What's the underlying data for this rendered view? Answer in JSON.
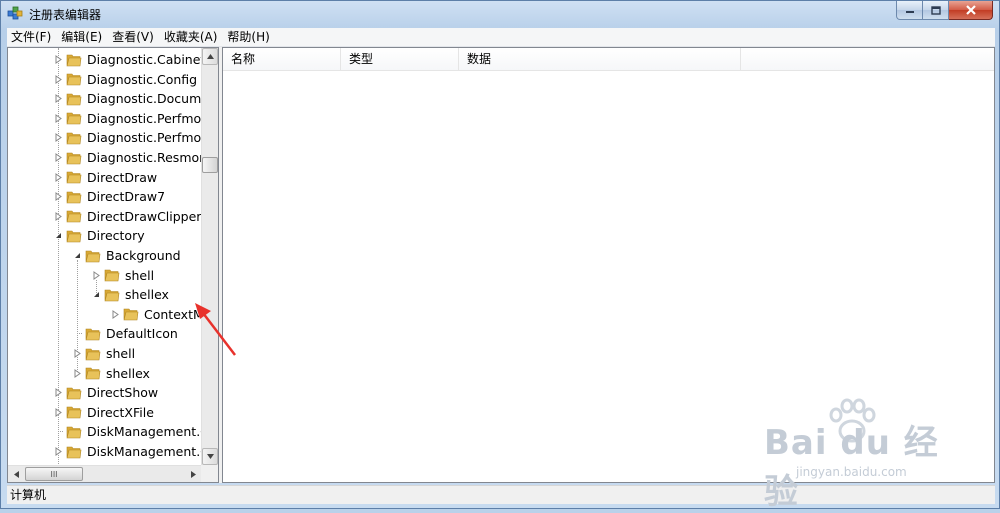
{
  "window": {
    "title": "注册表编辑器"
  },
  "menu": [
    "文件(F)",
    "编辑(E)",
    "查看(V)",
    "收藏夹(A)",
    "帮助(H)"
  ],
  "tree": {
    "items": [
      {
        "label": "Diagnostic.Cabinet",
        "level": 0,
        "expander": "collapsed"
      },
      {
        "label": "Diagnostic.Config",
        "level": 0,
        "expander": "collapsed"
      },
      {
        "label": "Diagnostic.Documen",
        "level": 0,
        "expander": "collapsed"
      },
      {
        "label": "Diagnostic.Perfmon",
        "level": 0,
        "expander": "collapsed"
      },
      {
        "label": "Diagnostic.Perfmon",
        "level": 0,
        "expander": "collapsed"
      },
      {
        "label": "Diagnostic.Resmon.",
        "level": 0,
        "expander": "collapsed"
      },
      {
        "label": "DirectDraw",
        "level": 0,
        "expander": "collapsed"
      },
      {
        "label": "DirectDraw7",
        "level": 0,
        "expander": "collapsed"
      },
      {
        "label": "DirectDrawClipper",
        "level": 0,
        "expander": "collapsed"
      },
      {
        "label": "Directory",
        "level": 0,
        "expander": "expanded"
      },
      {
        "label": "Background",
        "level": 1,
        "expander": "expanded"
      },
      {
        "label": "shell",
        "level": 2,
        "expander": "collapsed"
      },
      {
        "label": "shellex",
        "level": 2,
        "expander": "expanded"
      },
      {
        "label": "ContextM",
        "level": 3,
        "expander": "collapsed"
      },
      {
        "label": "DefaultIcon",
        "level": 1,
        "expander": "none"
      },
      {
        "label": "shell",
        "level": 1,
        "expander": "collapsed"
      },
      {
        "label": "shellex",
        "level": 1,
        "expander": "collapsed"
      },
      {
        "label": "DirectShow",
        "level": 0,
        "expander": "collapsed"
      },
      {
        "label": "DirectXFile",
        "level": 0,
        "expander": "collapsed"
      },
      {
        "label": "DiskManagement.C",
        "level": 0,
        "expander": "none"
      },
      {
        "label": "DiskManagement.C",
        "level": 0,
        "expander": "collapsed"
      }
    ],
    "hscroll_grip": "III"
  },
  "list": {
    "columns": [
      "名称",
      "类型",
      "数据"
    ]
  },
  "status": {
    "text": "计算机"
  },
  "watermark": {
    "main": "Bai du 经验",
    "sub": "jingyan.baidu.com"
  },
  "colors": {
    "folder": "#e8c25a",
    "annotation_arrow": "#e8322c"
  }
}
